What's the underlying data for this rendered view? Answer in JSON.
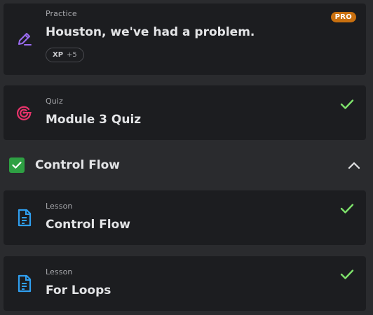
{
  "items": [
    {
      "kind": "Practice",
      "title": "Houston, we've had a problem.",
      "badge": "PRO",
      "xp_label": "XP",
      "xp_value": "+5",
      "icon": "pencil-icon",
      "completed": false
    },
    {
      "kind": "Quiz",
      "title": "Module 3 Quiz",
      "icon": "target-icon",
      "completed": true
    }
  ],
  "section": {
    "title": "Control Flow",
    "completed": true,
    "expanded": true
  },
  "lessons": [
    {
      "kind": "Lesson",
      "title": "Control Flow",
      "icon": "document-icon",
      "completed": true
    },
    {
      "kind": "Lesson",
      "title": "For Loops",
      "icon": "document-icon",
      "completed": true
    }
  ],
  "colors": {
    "background": "#2a2b2e",
    "card": "#1c1d20",
    "check_green": "#7ee26b",
    "section_check": "#2ea043",
    "pro_badge": "#c9700f",
    "practice_icon": "#9b6cf0",
    "quiz_icon": "#e8336b",
    "lesson_icon": "#2f9ff0"
  }
}
